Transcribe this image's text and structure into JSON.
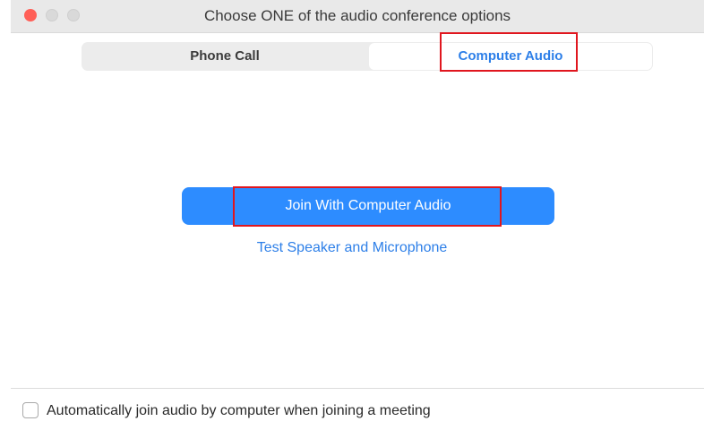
{
  "window": {
    "title": "Choose ONE of the audio conference options"
  },
  "tabs": [
    {
      "label": "Phone Call",
      "selected": false
    },
    {
      "label": "Computer Audio",
      "selected": true
    }
  ],
  "main": {
    "join_button_label": "Join With Computer Audio",
    "test_link_label": "Test Speaker and Microphone"
  },
  "footer": {
    "auto_join_label": "Automatically join audio by computer when joining a meeting",
    "auto_join_checked": false
  },
  "colors": {
    "accent": "#2d8cff",
    "link": "#2d7fe8",
    "highlight": "#e0161e",
    "close": "#ff5f57"
  },
  "icons": [
    "close-window-icon",
    "minimize-window-icon",
    "maximize-window-icon"
  ]
}
